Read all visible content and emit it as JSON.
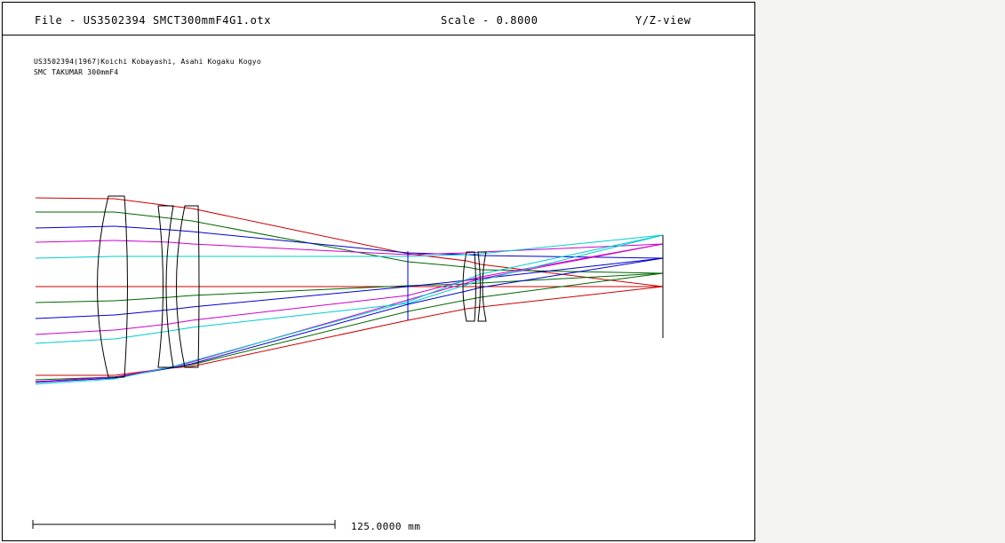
{
  "header": {
    "file": "File - US3502394 SMCT300mmF4G1.otx",
    "scale": "Scale - 0.8000",
    "view": "Y/Z-view"
  },
  "notes": {
    "line1": "US3502394(1967)Koichi Kobayashi, Asahi Kogaku Kogyo",
    "line2": "SMC TAKUMAR 300mmF4"
  },
  "scale_bar": {
    "label": "125.0000 mm"
  },
  "colors": {
    "lens": "#000000",
    "stop": "#0000cc",
    "ray_red": "#cc0000",
    "ray_green": "#006600",
    "ray_blue": "#0000cc",
    "ray_magenta": "#cc00cc",
    "ray_cyan": "#00cccc"
  }
}
